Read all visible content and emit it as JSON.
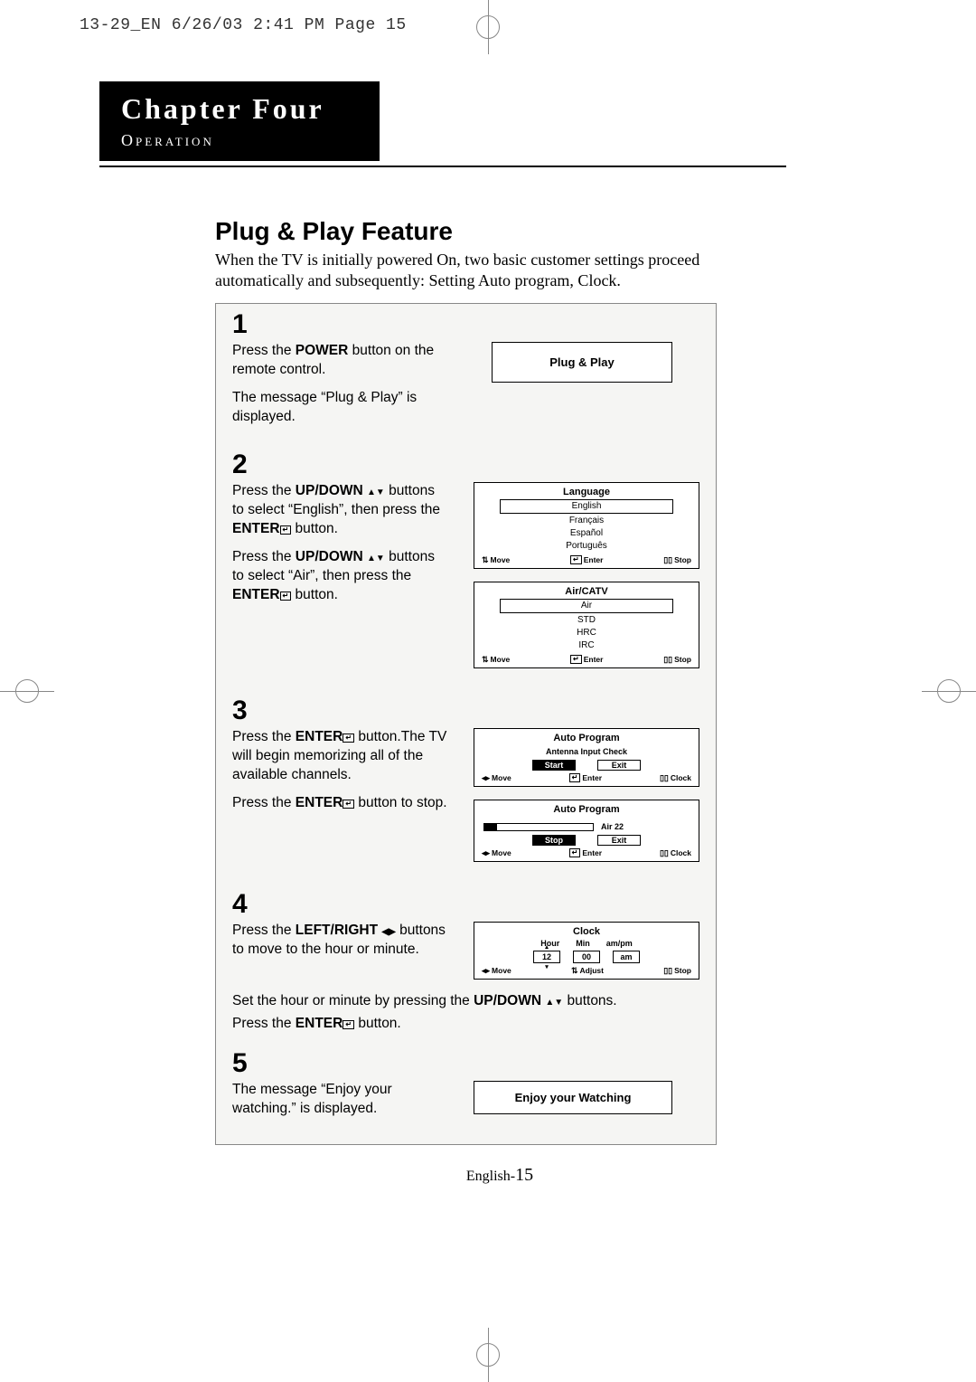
{
  "scan_header": "13-29_EN  6/26/03 2:41 PM  Page 15",
  "chapter": {
    "title": "Chapter Four",
    "subtitle": "Operation"
  },
  "feature": {
    "title": "Plug & Play Feature",
    "intro": "When the TV is initially powered On, two basic customer settings proceed automatically and subsequently: Setting Auto program, Clock."
  },
  "steps": {
    "s1": {
      "num": "1",
      "line1a": "Press the ",
      "line1b": "POWER",
      "line1c": " button on the remote control.",
      "line2": "The message “Plug & Play” is displayed.",
      "osd_label": "Plug & Play"
    },
    "s2": {
      "num": "2",
      "p1a": "Press the ",
      "p1b": "UP/DOWN",
      "p1c": " buttons to select “English”, then press the ",
      "p1d": "ENTER",
      "p1e": " button.",
      "p2a": "Press the ",
      "p2b": "UP/DOWN",
      "p2c": " buttons to select “Air”, then press the ",
      "p2d": "ENTER",
      "p2e": " button.",
      "lang_osd": {
        "title": "Language",
        "opts": [
          "English",
          "Français",
          "Español",
          "Português"
        ],
        "foot": [
          "Move",
          "Enter",
          "Stop"
        ]
      },
      "air_osd": {
        "title": "Air/CATV",
        "opts": [
          "Air",
          "STD",
          "HRC",
          "IRC"
        ],
        "foot": [
          "Move",
          "Enter",
          "Stop"
        ]
      }
    },
    "s3": {
      "num": "3",
      "p1a": "Press the ",
      "p1b": "ENTER",
      "p1c": " button.The TV will begin memorizing all of the available channels.",
      "p2a": "Press the ",
      "p2b": "ENTER",
      "p2c": " button to stop.",
      "auto1": {
        "title": "Auto Program",
        "sub": "Antenna Input Check",
        "btn1": "Start",
        "btn2": "Exit",
        "foot": [
          "Move",
          "Enter",
          "Clock"
        ]
      },
      "auto2": {
        "title": "Auto Program",
        "progress_label": "Air 22",
        "btn1": "Stop",
        "btn2": "Exit",
        "foot": [
          "Move",
          "Enter",
          "Clock"
        ]
      }
    },
    "s4": {
      "num": "4",
      "p1a": "Press the ",
      "p1b": "LEFT/RIGHT",
      "p1c": " buttons to move to the hour or minute.",
      "p2a": "Set the hour or minute by pressing the ",
      "p2b": "UP/DOWN",
      "p2c": " buttons.",
      "p3a": "Press the ",
      "p3b": "ENTER",
      "p3c": " button.",
      "clock": {
        "title": "Clock",
        "cols": [
          "Hour",
          "Min",
          "am/pm"
        ],
        "vals": [
          "12",
          "00",
          "am"
        ],
        "foot": [
          "Move",
          "Adjust",
          "Stop"
        ]
      }
    },
    "s5": {
      "num": "5",
      "p1": "The message “Enjoy your watching.” is displayed.",
      "osd_label": "Enjoy your Watching"
    }
  },
  "footer": {
    "lang": "English-",
    "page": "15"
  }
}
